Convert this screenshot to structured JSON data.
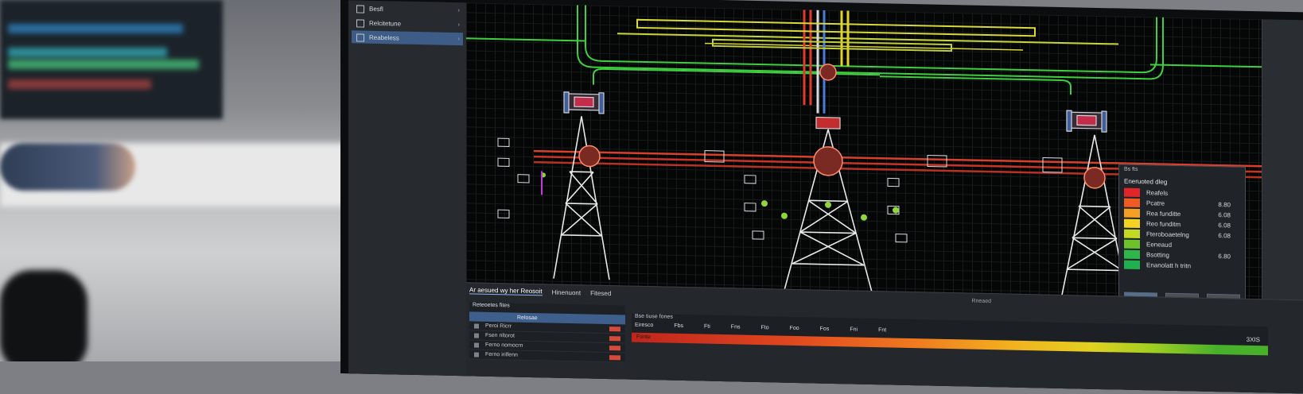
{
  "left_panel": {
    "items": [
      {
        "label": "Besfl",
        "active": false
      },
      {
        "label": "Relcitetune",
        "active": false
      },
      {
        "label": "Reabeless",
        "active": true
      }
    ]
  },
  "legend": {
    "header": "Bs fts",
    "title": "Eneruoted dleg",
    "rows": [
      {
        "label": "Reafels",
        "value": "",
        "color": "#e0262b"
      },
      {
        "label": "Pcatre",
        "value": "8.80",
        "color": "#f05a23"
      },
      {
        "label": "Rea funditte",
        "value": "6.08",
        "color": "#f5a023"
      },
      {
        "label": "Reo funditm",
        "value": "6.08",
        "color": "#f2d321"
      },
      {
        "label": "Fteroboaetelng",
        "value": "6.08",
        "color": "#c3d923"
      },
      {
        "label": "Eeneaud",
        "value": "",
        "color": "#6cc22b"
      },
      {
        "label": "Bsotting",
        "value": "6.80",
        "color": "#2fb54a"
      },
      {
        "label": "Enanolatt h tritn",
        "value": "",
        "color": "#21b04e"
      }
    ],
    "buttons": [
      "Rsd",
      "1sa",
      "Ruo"
    ]
  },
  "bottom": {
    "tabs": [
      "Ar aesued wy her Reosoit",
      "Hinenuont",
      "Fitesed"
    ],
    "status": "Rneaed",
    "left_table": {
      "title": "Reteoetes fites",
      "head": [
        "",
        "Relosae"
      ],
      "rows": [
        "Peroi Ricrr",
        "Fsen nltorot",
        "Ferno nomocrn",
        "Ferno irilfenn"
      ]
    },
    "right_table": {
      "title": "Bse tiuse fones",
      "head": [
        "Eiresco",
        "Fbs",
        "Fti",
        "Fns",
        "Fto",
        "Foo",
        "Fos",
        "Fni",
        "Fnt"
      ],
      "bar_label": "Fonte",
      "corner": "3XIS"
    }
  }
}
